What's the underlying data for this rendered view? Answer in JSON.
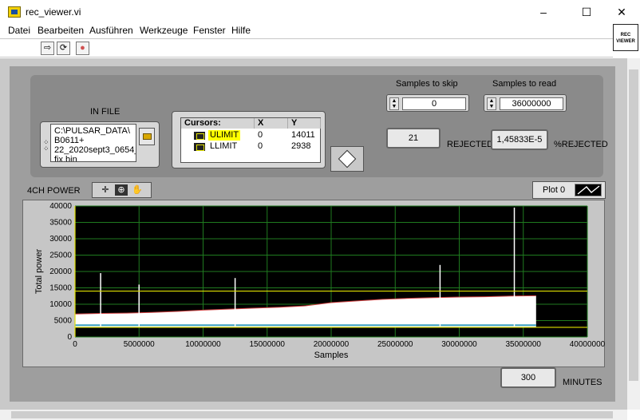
{
  "window": {
    "title": "rec_viewer.vi",
    "controls": [
      "–",
      "☐",
      "✕"
    ]
  },
  "menu": [
    "Datei",
    "Bearbeiten",
    "Ausführen",
    "Werkzeuge",
    "Fenster",
    "Hilfe"
  ],
  "toolbar": {
    "run": "⇨",
    "run_continuous": "⟳",
    "abort": "●"
  },
  "vi_icon": "REC VIEWER",
  "in_file": {
    "label": "IN FILE",
    "path_lines": [
      "C:\\PULSAR_DATA\\",
      "B0611+",
      "22_2020sept3_0654_",
      "fix.bin"
    ]
  },
  "cursors": {
    "headers": [
      "Cursors:",
      "X",
      "Y"
    ],
    "rows": [
      {
        "name": "ULIMIT",
        "x": "0",
        "y": "14011"
      },
      {
        "name": "LLIMIT",
        "x": "0",
        "y": "2938"
      }
    ]
  },
  "samples_to_skip": {
    "label": "Samples to skip",
    "value": "0"
  },
  "samples_to_read": {
    "label": "Samples to read",
    "value": "36000000"
  },
  "rejected": {
    "value": "21",
    "label": "REJECTED"
  },
  "pct_rejected": {
    "value": "1,45833E-5",
    "label": "%REJECTED"
  },
  "graph": {
    "title": "4CH POWER",
    "legend": "Plot 0",
    "xlabel": "Samples",
    "ylabel": "Total power"
  },
  "minutes": {
    "value": "300",
    "label": "MINUTES"
  },
  "colors": {
    "panel": "#c9c9c9",
    "plot_bg": "#000000",
    "grid": "#1f7a1f",
    "signal": "#ffffff",
    "cursor_line": "#e0e000"
  },
  "chart_data": {
    "type": "line",
    "xlabel": "Samples",
    "ylabel": "Total power",
    "xlim": [
      0,
      40000000
    ],
    "ylim": [
      0,
      40000
    ],
    "x_ticks": [
      0,
      5000000,
      10000000,
      15000000,
      20000000,
      25000000,
      30000000,
      35000000,
      40000000
    ],
    "y_ticks": [
      0,
      5000,
      10000,
      15000,
      20000,
      25000,
      30000,
      35000,
      40000
    ],
    "grid": true,
    "series": [
      {
        "x": [
          0,
          2000000,
          4000000,
          6000000,
          8000000,
          10000000,
          12000000,
          14000000,
          16000000,
          18000000,
          20000000,
          22000000,
          24000000,
          26000000,
          28000000,
          30000000,
          32000000,
          34000000,
          36000000
        ],
        "y": [
          7000,
          7200,
          7300,
          7500,
          7800,
          8200,
          8500,
          8800,
          9100,
          9500,
          10500,
          11000,
          11500,
          11800,
          12000,
          12200,
          12300,
          12500,
          12600
        ]
      }
    ],
    "spikes": [
      {
        "x": 2000000,
        "y": 19500
      },
      {
        "x": 5000000,
        "y": 16000
      },
      {
        "x": 12500000,
        "y": 18000
      },
      {
        "x": 28500000,
        "y": 22000
      },
      {
        "x": 34300000,
        "y": 39500
      }
    ],
    "baseline": 3000,
    "cursor_levels": [
      14011,
      2938
    ]
  }
}
